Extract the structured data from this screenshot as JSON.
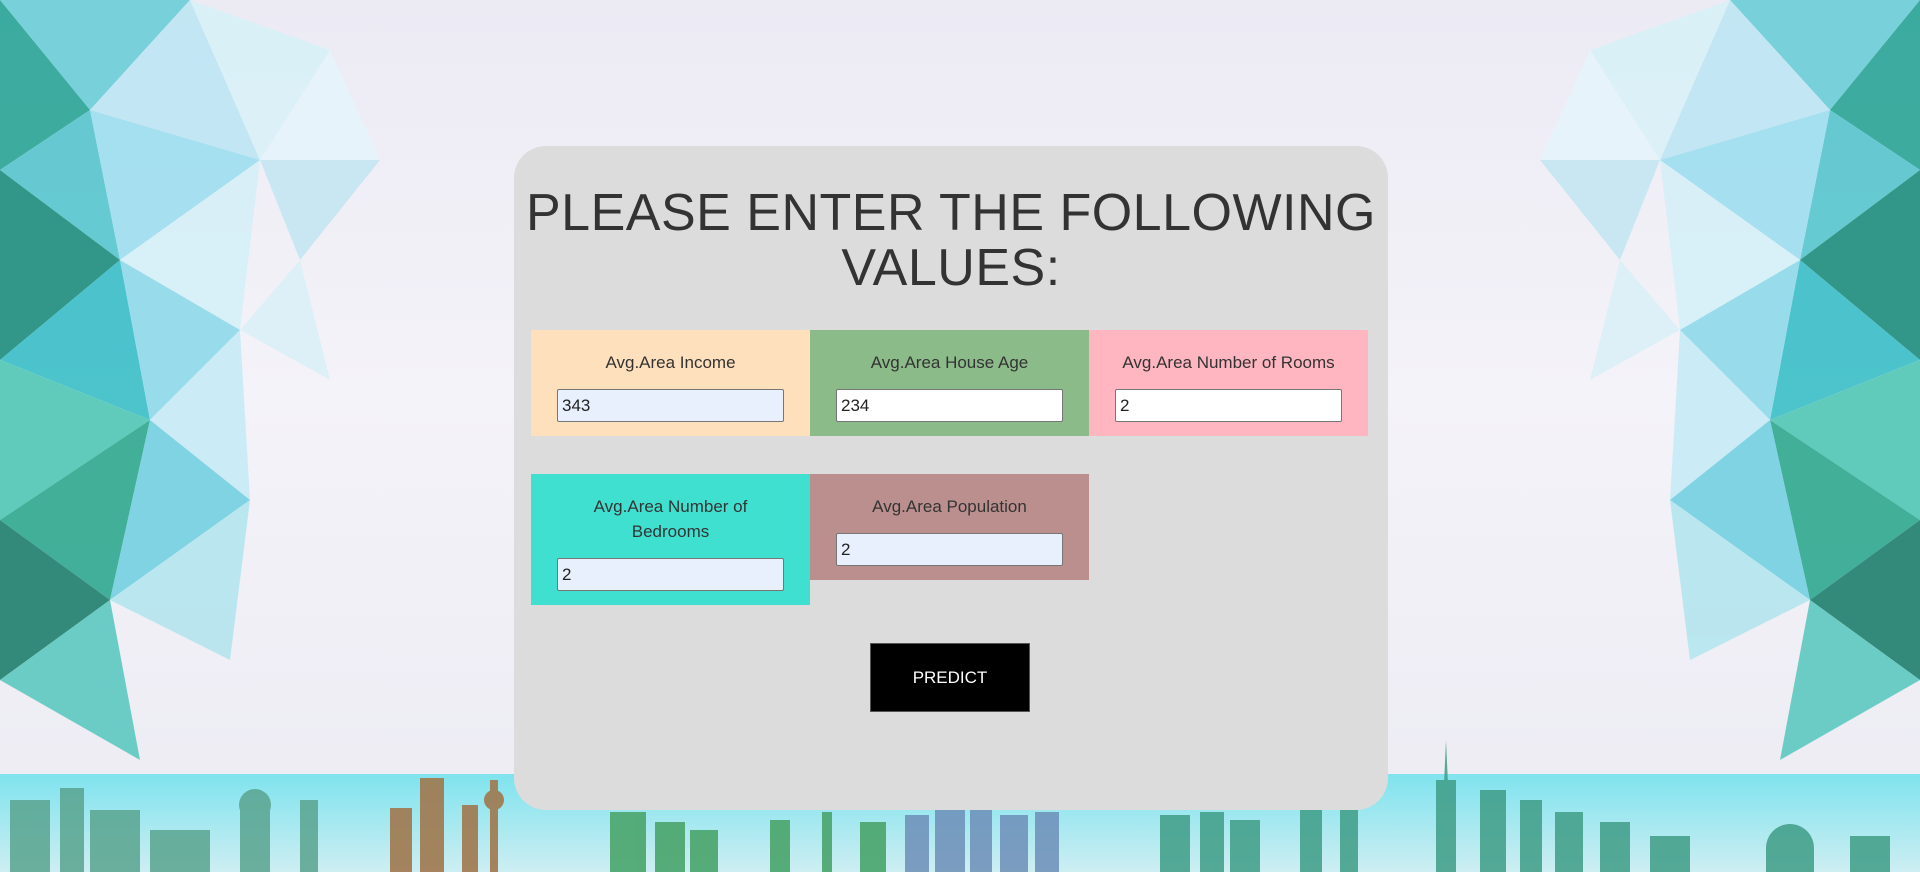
{
  "form": {
    "title": "PLEASE ENTER THE FOLLOWING VALUES:",
    "fields": [
      {
        "label": "Avg.Area Income",
        "value": "343",
        "color": "#ffe0bd"
      },
      {
        "label": "Avg.Area House Age",
        "value": "234",
        "color": "#8cbb8a"
      },
      {
        "label": "Avg.Area Number of Rooms",
        "value": "2",
        "color": "#ffb6c1"
      },
      {
        "label": "Avg.Area Number of Bedrooms",
        "value": "2",
        "color": "#40e0d0"
      },
      {
        "label": "Avg.Area Population",
        "value": "2",
        "color": "#bc8f8f"
      }
    ],
    "predict_label": "PREDICT"
  },
  "colors": {
    "card_background": "#dcdcdc",
    "title_text": "#333333",
    "button_background": "#000000",
    "button_text": "#ffffff",
    "autofill_input": "#e8f0fe"
  }
}
